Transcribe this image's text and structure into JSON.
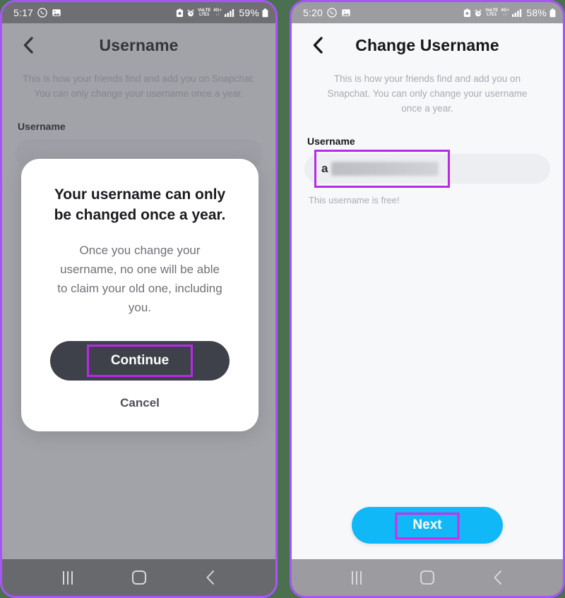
{
  "theme": {
    "highlight_purple": "#b829e8",
    "frame_purple": "#a855f7",
    "divider_green": "#4a7050",
    "next_blue": "#11b8f7",
    "continue_dark": "#3e4149"
  },
  "left_phone": {
    "status_bar": {
      "time": "5:17",
      "icons_left": [
        "whatsapp-icon",
        "photo-icon"
      ],
      "icons_right": [
        "battery-saver-icon",
        "alarm-icon",
        "volte-icon",
        "network-4gplus-icon",
        "signal-icon"
      ],
      "volte_top": "VoLTE",
      "volte_bottom": "LTE1",
      "network_top": "4G+",
      "network_bottom": "↓↑",
      "battery": "59%"
    },
    "appbar": {
      "back_icon": "chevron-left-icon",
      "title": "Username"
    },
    "subtitle": "This is how your friends find and add you on Snapchat.\nYou can only change your username once a year.",
    "field_label": "Username",
    "input_value": "",
    "modal": {
      "title": "Your username can only be changed once a year.",
      "body": "Once you change your username, no one will be able to claim your old one, including you.",
      "primary_button": "Continue",
      "secondary_button": "Cancel"
    },
    "navbar": {
      "recents": "recents-icon",
      "home": "home-icon",
      "back": "back-icon"
    }
  },
  "right_phone": {
    "status_bar": {
      "time": "5:20",
      "icons_left": [
        "whatsapp-icon",
        "photo-icon"
      ],
      "icons_right": [
        "battery-saver-icon",
        "alarm-icon",
        "volte-icon",
        "network-4gplus-icon",
        "signal-icon"
      ],
      "volte_top": "VoLTE",
      "volte_bottom": "LTE1",
      "network_top": "4G+",
      "network_bottom": "↓↑",
      "battery": "58%"
    },
    "appbar": {
      "back_icon": "chevron-left-icon",
      "title": "Change Username"
    },
    "subtitle": "This is how your friends find and add you on Snapchat. You can only change your username once a year.",
    "field_label": "Username",
    "input_value": "a",
    "input_redacted": true,
    "helper_text": "This username is free!",
    "next_button": "Next",
    "navbar": {
      "recents": "recents-icon",
      "home": "home-icon",
      "back": "back-icon"
    }
  }
}
